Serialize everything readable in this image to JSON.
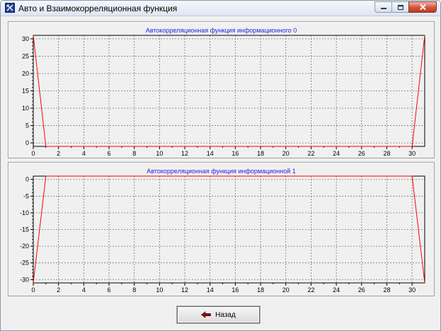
{
  "window": {
    "title": "Авто и Взаимокорреляционная функция",
    "icon": "app-icon"
  },
  "footer": {
    "back_label": "Назад",
    "back_icon": "arrow-left-icon"
  },
  "colors": {
    "title_text": "#2222dd",
    "series": "#ff0000"
  },
  "chart_data": [
    {
      "type": "line",
      "title": "Автокорреляционная функция информационного 0",
      "xlim": [
        0,
        31
      ],
      "ylim": [
        -1,
        31
      ],
      "xticks": [
        0,
        2,
        4,
        6,
        8,
        10,
        12,
        14,
        16,
        18,
        20,
        22,
        24,
        26,
        28,
        30
      ],
      "yticks": [
        0,
        5,
        10,
        15,
        20,
        25,
        30
      ],
      "grid": true,
      "series": [
        {
          "x": [
            0,
            1,
            2,
            3,
            4,
            5,
            6,
            7,
            8,
            9,
            10,
            11,
            12,
            13,
            14,
            15,
            16,
            17,
            18,
            19,
            20,
            21,
            22,
            23,
            24,
            25,
            26,
            27,
            28,
            29,
            30,
            31
          ],
          "y": [
            31,
            -1,
            -1,
            -1,
            -1,
            -1,
            -1,
            -1,
            -1,
            -1,
            -1,
            -1,
            -1,
            -1,
            -1,
            -1,
            -1,
            -1,
            -1,
            -1,
            -1,
            -1,
            -1,
            -1,
            -1,
            -1,
            -1,
            -1,
            -1,
            -1,
            -1,
            31
          ]
        }
      ]
    },
    {
      "type": "line",
      "title": "Автокорреляционная функция информационной 1",
      "xlim": [
        0,
        31
      ],
      "ylim": [
        -31,
        1
      ],
      "xticks": [
        0,
        2,
        4,
        6,
        8,
        10,
        12,
        14,
        16,
        18,
        20,
        22,
        24,
        26,
        28,
        30
      ],
      "yticks": [
        0,
        -5,
        -10,
        -15,
        -20,
        -25,
        -30
      ],
      "grid": true,
      "series": [
        {
          "x": [
            0,
            1,
            2,
            3,
            4,
            5,
            6,
            7,
            8,
            9,
            10,
            11,
            12,
            13,
            14,
            15,
            16,
            17,
            18,
            19,
            20,
            21,
            22,
            23,
            24,
            25,
            26,
            27,
            28,
            29,
            30,
            31
          ],
          "y": [
            -31,
            1,
            1,
            1,
            1,
            1,
            1,
            1,
            1,
            1,
            1,
            1,
            1,
            1,
            1,
            1,
            1,
            1,
            1,
            1,
            1,
            1,
            1,
            1,
            1,
            1,
            1,
            1,
            1,
            1,
            1,
            -31
          ]
        }
      ]
    }
  ]
}
